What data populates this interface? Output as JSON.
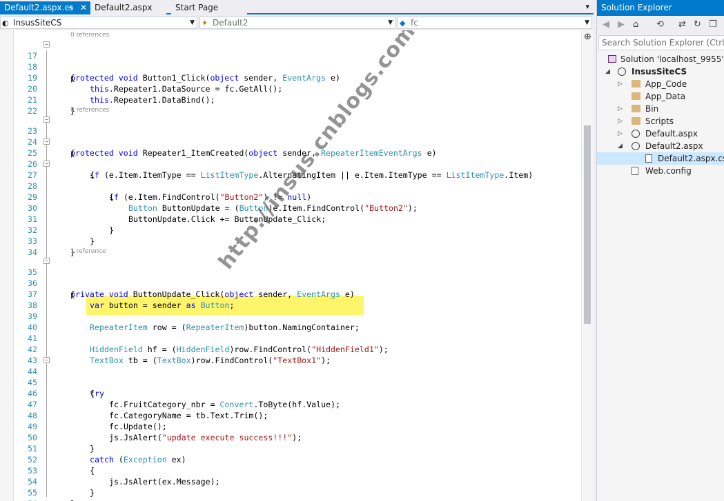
{
  "editor": {
    "tabs": [
      {
        "label": "Default2.aspx.cs",
        "active": true,
        "pin": "⊸",
        "close": "✕"
      },
      {
        "label": "Default2.aspx",
        "active": false
      },
      {
        "label": "Start Page",
        "active": false
      }
    ],
    "tab_overflow": "▾",
    "nav": {
      "project": "InsusSiteCS",
      "class": "Default2",
      "member": "fc"
    },
    "watermark": "http://insus.cnblogs.com",
    "lens": {
      "l1": "0 references",
      "l2": "0 references",
      "l3": "1 reference"
    },
    "lines": {
      "n17": "17",
      "n18": "18",
      "n19": "19",
      "n20": "20",
      "n21": "21",
      "n22": "22",
      "n23": "23",
      "n24": "24",
      "n25": "25",
      "n26": "26",
      "n27": "27",
      "n28": "28",
      "n29": "29",
      "n30": "30",
      "n31": "31",
      "n32": "32",
      "n33": "33",
      "n34": "34",
      "n35": "35",
      "n36": "36",
      "n37": "37",
      "n38": "38",
      "n39": "39",
      "n40": "40",
      "n41": "41",
      "n42": "42",
      "n43": "43",
      "n44": "44",
      "n45": "45",
      "n46": "46",
      "n47": "47",
      "n48": "48",
      "n49": "49",
      "n50": "50",
      "n51": "51",
      "n52": "52",
      "n53": "53",
      "n54": "54",
      "n55": "55",
      "n56": "56"
    },
    "tokens": {
      "protected": "protected",
      "private": "private",
      "void": "void",
      "object": "object",
      "this": "this.",
      "if": "if",
      "null": "null",
      "var": "var",
      "as": "as",
      "try": "try",
      "catch": "catch",
      "EventArgs": "EventArgs",
      "RepeaterItemEventArgs": "RepeaterItemEventArgs",
      "ListItemType": "ListItemType",
      "Button": "Button",
      "RepeaterItem": "RepeaterItem",
      "HiddenField": "HiddenField",
      "TextBox": "TextBox",
      "Convert": "Convert",
      "Exception": "Exception",
      "s_Button2": "\"Button2\"",
      "s_HiddenField1": "\"HiddenField1\"",
      "s_TextBox1": "\"TextBox1\"",
      "s_update": "\"update execute success!!!\"",
      "c17": " Button1_Click(",
      "c17b": " sender, ",
      "c17c": " e)",
      "open_brace": "{",
      "close_brace": "}",
      "c19": "Repeater1.DataSource = fc.GetAll();",
      "c20": "Repeater1.DataBind();",
      "c23": " Repeater1_ItemCreated(",
      "c25a": " (e.Item.ItemType == ",
      "c25b": ".AlternatingItem || e.Item.ItemType == ",
      "c25c": ".Item)",
      "c27a": " (e.Item.FindControl(",
      "c27b": ") != ",
      "c27c": ")",
      "c29a": " ButtonUpdate = (",
      "c29b": ")e.Item.FindControl(",
      "c29c": ");",
      "c30": "ButtonUpdate.Click += ButtonUpdate_Click;",
      "c35": " ButtonUpdate_Click(",
      "c37a": " button = sender ",
      "c37b": ";",
      "c39a": " row = (",
      "c39b": ")button.NamingContainer;",
      "c41a": " hf = (",
      "c41b": ")row.FindControl(",
      "c42a": " tb = (",
      "c46a": "fc.FruitCategory_nbr = ",
      "c46b": ".ToByte(hf.Value);",
      "c47": "fc.CategoryName = tb.Text.Trim();",
      "c48": "fc.Update();",
      "c49a": "js.JsAlert(",
      "c49b": ");",
      "c51a": " (",
      "c51b": " ex)",
      "c53": "js.JsAlert(ex.Message);"
    }
  },
  "solution_explorer": {
    "title": "Solution Explorer",
    "search_placeholder": "Search Solution Explorer (Ctrl+;)",
    "tree": {
      "solution": "Solution 'localhost_9955' (1 p",
      "project": "InsusSiteCS",
      "app_code": "App_Code",
      "app_data": "App_Data",
      "bin": "Bin",
      "scripts": "Scripts",
      "default": "Default.aspx",
      "default2": "Default2.aspx",
      "default2_cs": "Default2.aspx.cs",
      "web_config": "Web.config"
    }
  },
  "colors": {
    "accent": "#007acc",
    "keyword": "#0000ff",
    "type": "#2b91af",
    "string": "#a31515",
    "highlight": "#fff56b"
  }
}
